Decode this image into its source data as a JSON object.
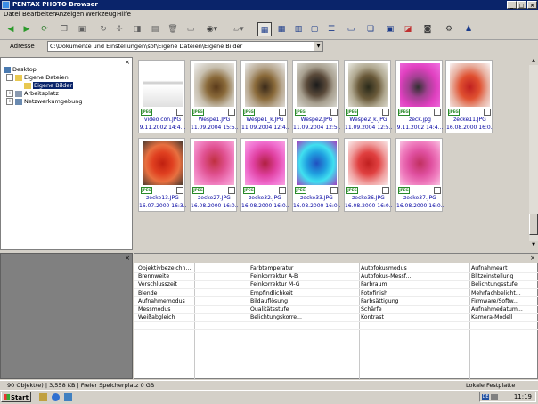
{
  "window": {
    "title": "PENTAX PHOTO Browser",
    "buttons": {
      "minimize": "_",
      "maximize": "□",
      "close": "×"
    }
  },
  "menu": [
    "Datei",
    "Bearbeiten",
    "Anzeigen",
    "Werkzeug",
    "Hilfe"
  ],
  "toolbar": {
    "icons": [
      "back-icon",
      "forward-icon",
      "refresh-icon",
      "copy-icon",
      "move-icon",
      "rotate-icon",
      "move-tool-icon",
      "delete-icon",
      "trash-icon",
      "view-eye-icon",
      "folder-icon",
      "thumbnail-view-icon",
      "small-thumb-view-icon",
      "list-view-icon",
      "detail-view-icon",
      "preview-view-icon",
      "properties-icon",
      "print-icon",
      "slideshow-icon",
      "camera-icon",
      "palette-icon",
      "settings-icon",
      "help-icon"
    ]
  },
  "address": {
    "label": "Adresse",
    "value": "C:\\Dokumente und Einstellungen\\sof\\Eigene Dateien\\Eigene Bilder"
  },
  "tree": {
    "items": [
      {
        "label": "Desktop",
        "level": 0
      },
      {
        "label": "Eigene Dateien",
        "level": 1
      },
      {
        "label": "Eigene Bilder",
        "level": 2,
        "selected": true
      },
      {
        "label": "Arbeitsplatz",
        "level": 1
      },
      {
        "label": "Netzwerkumgebung",
        "level": 1
      }
    ]
  },
  "thumbnails": [
    {
      "name": "video con.JPG",
      "date": "9.11.2002 14:4...",
      "badge": "JPEG",
      "kind": "doc"
    },
    {
      "name": "Wespe1.JPG",
      "date": "11.09.2004 15:5...",
      "badge": "JPEG",
      "kind": "wasp"
    },
    {
      "name": "Wespe1_k.JPG",
      "date": "11.09.2004 12:4...",
      "badge": "JPEG",
      "kind": "wasp2"
    },
    {
      "name": "Wespe2.JPG",
      "date": "11.09.2004 12:5...",
      "badge": "JPEG",
      "kind": "wasp3"
    },
    {
      "name": "Wespe2_k.JPG",
      "date": "11.09.2004 12:5...",
      "badge": "JPEG",
      "kind": "wasp4"
    },
    {
      "name": "zeck.jpg",
      "date": "9.11.2002 14:4...",
      "badge": "JPEG",
      "kind": "pink"
    },
    {
      "name": "zecke11.JPG",
      "date": "16.08.2000 16:0...",
      "badge": "JPEG",
      "kind": "red"
    },
    {
      "name": "zecke13.JPG",
      "date": "16.07.2000 16:3...",
      "badge": "JPEG",
      "kind": "orange"
    },
    {
      "name": "zecke27.JPG",
      "date": "16.08.2000 16:0...",
      "badge": "JPEG",
      "kind": "pink2"
    },
    {
      "name": "zecke32.JPG",
      "date": "16.08.2000 16:0...",
      "badge": "JPEG",
      "kind": "pink3"
    },
    {
      "name": "zecke33.JPG",
      "date": "16.08.2000 16:0...",
      "badge": "JPEG",
      "kind": "cyan"
    },
    {
      "name": "zecke36.JPG",
      "date": "16.08.2000 16:0...",
      "badge": "JPEG",
      "kind": "red2"
    },
    {
      "name": "zecke37.JPG",
      "date": "16.08.2000 16:0...",
      "badge": "JPEG",
      "kind": "pink4"
    }
  ],
  "properties": {
    "col1": [
      "Objektivbezeichn...",
      "Brennweite",
      "Verschlusszeit",
      "Blende",
      "Aufnahmemodus",
      "Messmodus",
      "Weißabgleich"
    ],
    "col2": [
      "Farbtemperatur",
      "Feinkorrektur A-B",
      "Feinkorrektur M-G",
      "Empfindlichkeit",
      "Bildauflösung",
      "Qualitätsstufe",
      "Belichtungskorre..."
    ],
    "col3": [
      "Autofokusmodus",
      "Autofokus-Messf...",
      "Farbraum",
      "Fotofinish",
      "Farbsättigung",
      "Schärfe",
      "Kontrast"
    ],
    "col4": [
      "Aufnahmeart",
      "Blitzeinstellung",
      "Belichtungsstufe",
      "Mehrfachbelicht...",
      "Firmware/Softw...",
      "Aufnahmedatum...",
      "Kamera-Modell"
    ]
  },
  "status": {
    "left": "90 Objekt(e) | 3,558 KB | Freier Speicherplatz 0 GB",
    "right": "Lokale Festplatte"
  },
  "taskbar": {
    "start": "Start",
    "clock": "11:19",
    "lang": "DE"
  }
}
